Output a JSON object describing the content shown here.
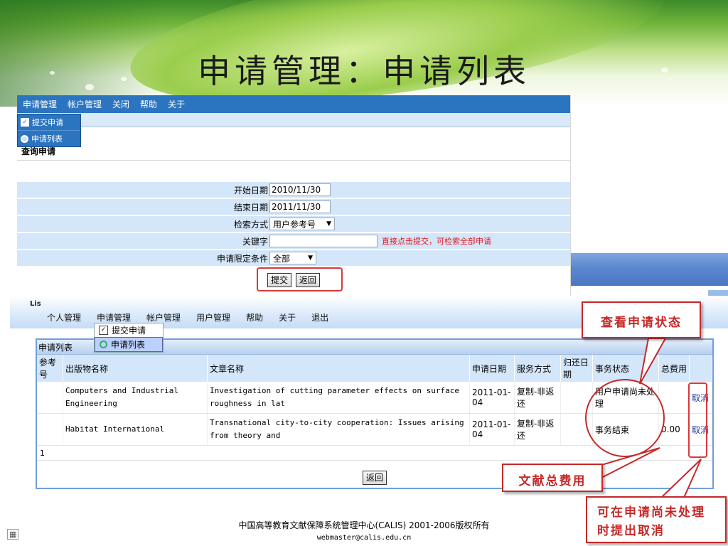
{
  "slide": {
    "title": "申请管理：申请列表"
  },
  "screen1": {
    "menu": [
      "申请管理",
      "帐户管理",
      "关闭",
      "帮助",
      "关于"
    ],
    "dropdown": [
      {
        "label": "提交申请",
        "icon": "checkbox-icon"
      },
      {
        "label": "申请列表",
        "icon": "magnifier-icon"
      }
    ],
    "heading": "查询申请",
    "form": {
      "start_label": "开始日期",
      "start_value": "2010/11/30",
      "end_label": "结束日期",
      "end_value": "2011/11/30",
      "method_label": "检索方式",
      "method_value": "用户参考号",
      "keyword_label": "关键字",
      "keyword_value": "",
      "keyword_hint": "直接点击提交，可检索全部申请",
      "limit_label": "申请限定条件",
      "limit_value": "全部"
    },
    "submit_label": "提交",
    "back_label": "返回"
  },
  "screen2": {
    "logo_fragment": "Lis",
    "menu": [
      "个人管理",
      "申请管理",
      "帐户管理",
      "用户管理",
      "帮助",
      "关于",
      "退出"
    ],
    "dropdown": [
      {
        "label": "提交申请",
        "icon": "checkbox-icon"
      },
      {
        "label": "申请列表",
        "icon": "magnifier-icon"
      }
    ],
    "list_title": "申请列表",
    "columns": [
      "参考号",
      "出版物名称",
      "文章名称",
      "申请日期",
      "服务方式",
      "归还日期",
      "事务状态",
      "总费用",
      ""
    ],
    "rows": [
      {
        "ref": "",
        "publication": "Computers and Industrial Engineering",
        "article": "Investigation of cutting parameter effects on surface roughness in lat",
        "date": "2011-01-04",
        "service": "复制-非返还",
        "return_date": "",
        "status": "用户申请尚未处理",
        "fee": "",
        "action": "取消"
      },
      {
        "ref": "",
        "publication": "Habitat International",
        "article": "Transnational city-to-city cooperation: Issues arising from theory and",
        "date": "2011-01-04",
        "service": "复制-非返还",
        "return_date": "",
        "status": "事务结束",
        "fee": "0.00",
        "action": "取消"
      }
    ],
    "page_number": "1",
    "back_label": "返回"
  },
  "footer": {
    "copyright": "中国高等教育文献保障系统管理中心(CALIS) 2001-2006版权所有",
    "email": "webmaster@calis.edu.cn"
  },
  "callouts": {
    "status": "查看申请状态",
    "fee": "文献总费用",
    "cancel": "可在申请尚未处理时提出取消"
  },
  "colors": {
    "menu_blue": "#2b74bf",
    "row_blue": "#d4e6f9",
    "callout_red": "#c62828",
    "hint_red": "#e0161d"
  }
}
